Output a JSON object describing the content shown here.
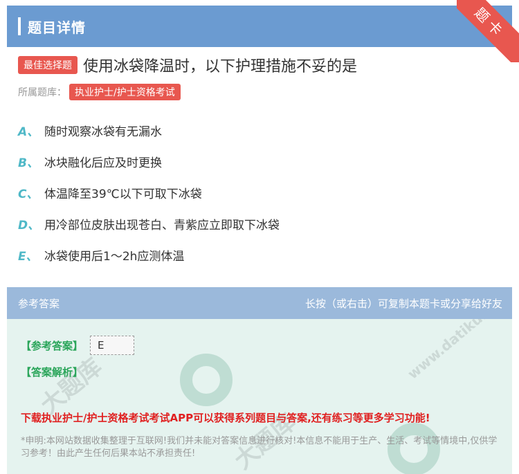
{
  "header": {
    "title": "题目详情",
    "corner_label": "题卡"
  },
  "question": {
    "type_tag": "最佳选择题",
    "text": "使用冰袋降温时，以下护理措施不妥的是",
    "library_label": "所属题库：",
    "library_name": "执业护士/护士资格考试"
  },
  "options": [
    {
      "letter": "A、",
      "text": "随时观察冰袋有无漏水"
    },
    {
      "letter": "B、",
      "text": "冰块融化后应及时更换"
    },
    {
      "letter": "C、",
      "text": "体温降至39℃以下可取下冰袋"
    },
    {
      "letter": "D、",
      "text": "用冷部位皮肤出现苍白、青紫应立即取下冰袋"
    },
    {
      "letter": "E、",
      "text": "冰袋使用后1～2h应测体温"
    }
  ],
  "answer_section": {
    "header_left": "参考答案",
    "header_right": "长按（或右击）可复制本题卡或分享给好友",
    "answer_label": "【参考答案】",
    "answer_value": "E",
    "analysis_label": "【答案解析】",
    "promo": "下载执业护士/护士资格考试考试APP可以获得系列题目与答案,还有练习等更多学习功能!",
    "disclaimer": "*申明:本网站数据收集整理于互联网!我们并未能对答案信息进行核对!本信息不能用于生产、生活、考试等情境中,仅供学习参考！由此产生任何后果本站不承担责任!"
  },
  "watermark": {
    "text": "大题库",
    "site": "www.datiku.com"
  },
  "colors": {
    "header": "#6b9bd1",
    "accent_red": "#e8574f",
    "option_letter": "#4fb8c7",
    "answer_green": "#2aa55a"
  }
}
